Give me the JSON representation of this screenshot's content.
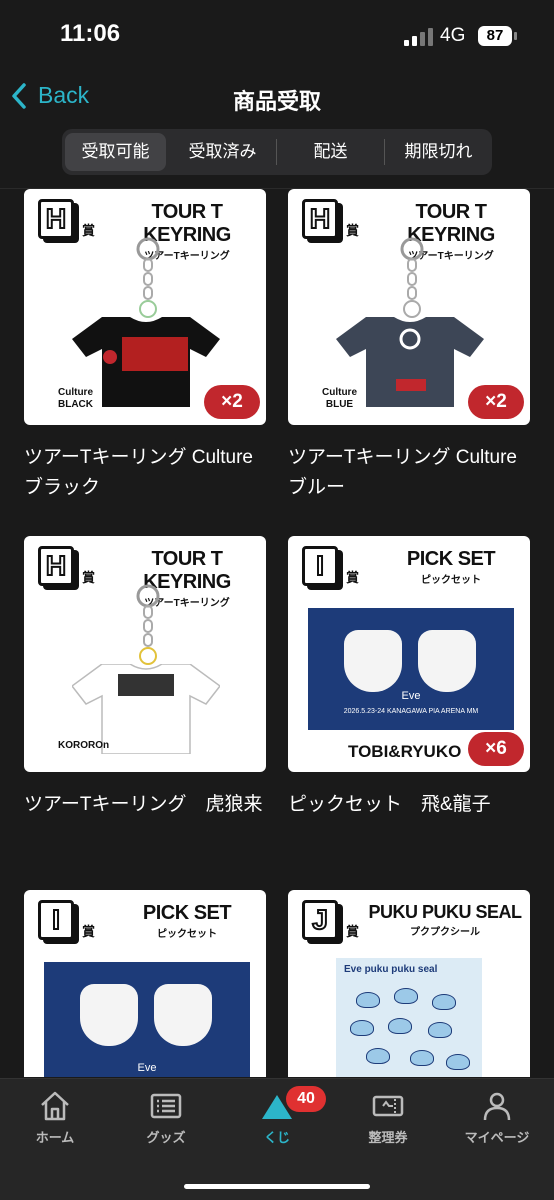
{
  "status_bar": {
    "time": "11:06",
    "network": "4G",
    "battery": "87"
  },
  "nav": {
    "back_label": "Back",
    "title": "商品受取"
  },
  "tabs": [
    {
      "label": "受取可能",
      "active": true
    },
    {
      "label": "受取済み",
      "active": false
    },
    {
      "label": "配送",
      "active": false
    },
    {
      "label": "期限切れ",
      "active": false
    }
  ],
  "cards": [
    {
      "prize_letter": "H",
      "prize_suffix": "賞",
      "heading_en": "TOUR T KEYRING",
      "heading_jp": "ツアーTキーリング",
      "tag_line1": "Culture",
      "tag_line2": "BLACK",
      "quantity": "×2",
      "name": "ツアーTキーリング Cultureブラック"
    },
    {
      "prize_letter": "H",
      "prize_suffix": "賞",
      "heading_en": "TOUR T KEYRING",
      "heading_jp": "ツアーTキーリング",
      "tag_line1": "Culture",
      "tag_line2": "BLUE",
      "quantity": "×2",
      "name": "ツアーTキーリング Cultureブルー"
    },
    {
      "prize_letter": "H",
      "prize_suffix": "賞",
      "heading_en": "TOUR T KEYRING",
      "heading_jp": "ツアーTキーリング",
      "tag_line1": "KOROROn",
      "tag_line2": "",
      "quantity": "",
      "name": "ツアーTキーリング　虎狼来"
    },
    {
      "prize_letter": "I",
      "prize_suffix": "賞",
      "heading_en": "PICK SET",
      "heading_jp": "ピックセット",
      "tag_line1": "TOBI&RYUKO",
      "tag_line2": "",
      "quantity": "×6",
      "name": "ピックセット　飛&龍子"
    },
    {
      "prize_letter": "I",
      "prize_suffix": "賞",
      "heading_en": "PICK SET",
      "heading_jp": "ピックセット",
      "tag_line1": "",
      "tag_line2": "",
      "quantity": "",
      "name": ""
    },
    {
      "prize_letter": "J",
      "prize_suffix": "賞",
      "heading_en": "PUKU PUKU SEAL",
      "heading_jp": "プクプクシール",
      "tag_line1": "",
      "tag_line2": "",
      "quantity": "",
      "name": ""
    }
  ],
  "pick_art": {
    "band": "Eve",
    "date": "2026.5.23-24 KANAGAWA PIA ARENA MM"
  },
  "seal_art": {
    "brand": "Eve  puku puku seal"
  },
  "tabbar": {
    "items": [
      {
        "label": "ホーム",
        "icon": "home-icon"
      },
      {
        "label": "グッズ",
        "icon": "goods-list-icon"
      },
      {
        "label": "くじ",
        "icon": "kuji-triangle-icon",
        "active": true
      },
      {
        "label": "整理券",
        "icon": "ticket-icon"
      },
      {
        "label": "マイページ",
        "icon": "person-icon"
      }
    ],
    "kuji_badge": "40"
  },
  "colors": {
    "accent": "#2cb5c9",
    "badge_red": "#e03131",
    "qty_red": "#c1272d"
  }
}
